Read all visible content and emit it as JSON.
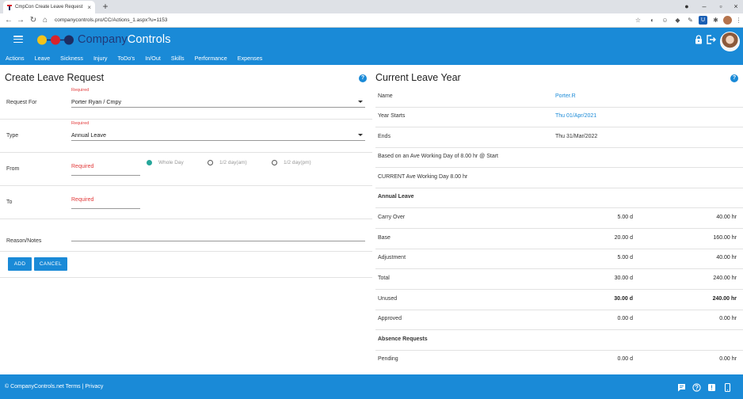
{
  "browser": {
    "tab_title": "CmpCon Create Leave Request",
    "url": "companycontrols.pro/CC/Actions_1.aspx?u=1153"
  },
  "header": {
    "brand_prefix": "Company",
    "brand_suffix": "Controls",
    "logo_colors": [
      "#f2c31b",
      "#d9242b",
      "#1d2d63"
    ]
  },
  "menu": [
    "Actions",
    "Leave",
    "Sickness",
    "Injury",
    "ToDo's",
    "In/Out",
    "Skills",
    "Performance",
    "Expenses"
  ],
  "form": {
    "title": "Create Leave Request",
    "request_for_label": "Request For",
    "request_for_required": "Required",
    "request_for_value": "Porter Ryan / Cmpy",
    "type_label": "Type",
    "type_required": "Required",
    "type_value": "Annual Leave",
    "from_label": "From",
    "from_required": "Required",
    "to_label": "To",
    "to_required": "Required",
    "radio_whole": "Whole Day",
    "radio_am": "1/2 day(am)",
    "radio_pm": "1/2 day(pm)",
    "reason_label": "Reason/Notes",
    "add_label": "ADD",
    "cancel_label": "CANCEL"
  },
  "leave_year": {
    "title": "Current Leave Year",
    "name_label": "Name",
    "name_value": "Porter.R",
    "starts_label": "Year Starts",
    "starts_value": "Thu 01/Apr/2021",
    "ends_label": "Ends",
    "ends_value": "Thu 31/Mar/2022",
    "based_on": "Based on an Ave Working Day of 8.00 hr @ Start",
    "current_ave": "CURRENT Ave Working Day 8.00 hr",
    "annual_leave_heading": "Annual Leave",
    "rows": [
      {
        "label": "Carry Over",
        "days": "5.00 d",
        "hours": "40.00 hr"
      },
      {
        "label": "Base",
        "days": "20.00 d",
        "hours": "160.00 hr"
      },
      {
        "label": "Adjustment",
        "days": "5.00 d",
        "hours": "40.00 hr"
      },
      {
        "label": "Total",
        "days": "30.00 d",
        "hours": "240.00 hr"
      },
      {
        "label": "Unused",
        "days": "30.00 d",
        "hours": "240.00 hr"
      },
      {
        "label": "Approved",
        "days": "0.00 d",
        "hours": "0.00 hr"
      }
    ],
    "absence_heading": "Absence Requests",
    "pending_label": "Pending",
    "pending_days": "0.00 d",
    "pending_hours": "0.00 hr"
  },
  "footer": {
    "text": "© CompanyControls.net Terms | Privacy"
  },
  "colors": {
    "accent": "#1a8ad7",
    "required": "#e23b3b",
    "radio_on": "#26a69a",
    "link": "#1a8ad7"
  }
}
